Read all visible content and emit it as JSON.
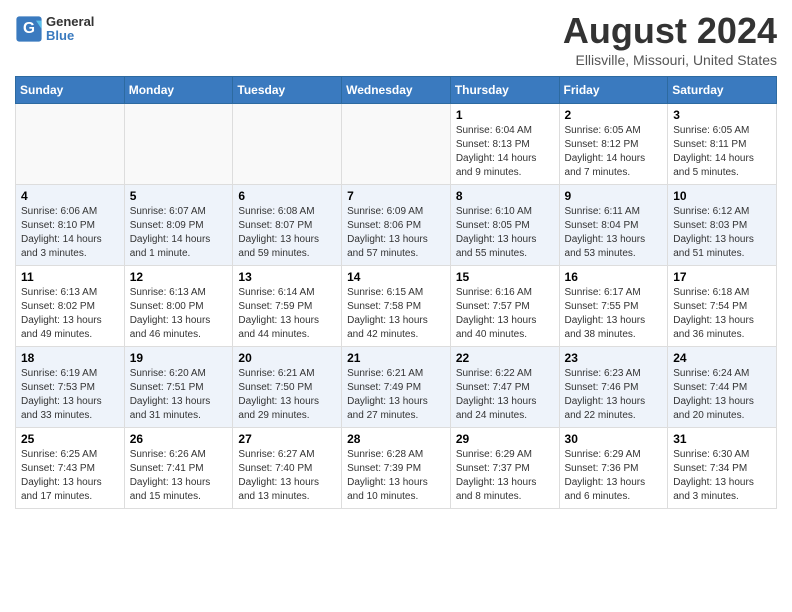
{
  "logo": {
    "general": "General",
    "blue": "Blue"
  },
  "title": "August 2024",
  "subtitle": "Ellisville, Missouri, United States",
  "days_of_week": [
    "Sunday",
    "Monday",
    "Tuesday",
    "Wednesday",
    "Thursday",
    "Friday",
    "Saturday"
  ],
  "weeks": [
    [
      {
        "day": "",
        "sunrise": "",
        "sunset": "",
        "daylight": ""
      },
      {
        "day": "",
        "sunrise": "",
        "sunset": "",
        "daylight": ""
      },
      {
        "day": "",
        "sunrise": "",
        "sunset": "",
        "daylight": ""
      },
      {
        "day": "",
        "sunrise": "",
        "sunset": "",
        "daylight": ""
      },
      {
        "day": "1",
        "sunrise": "Sunrise: 6:04 AM",
        "sunset": "Sunset: 8:13 PM",
        "daylight": "Daylight: 14 hours and 9 minutes."
      },
      {
        "day": "2",
        "sunrise": "Sunrise: 6:05 AM",
        "sunset": "Sunset: 8:12 PM",
        "daylight": "Daylight: 14 hours and 7 minutes."
      },
      {
        "day": "3",
        "sunrise": "Sunrise: 6:05 AM",
        "sunset": "Sunset: 8:11 PM",
        "daylight": "Daylight: 14 hours and 5 minutes."
      }
    ],
    [
      {
        "day": "4",
        "sunrise": "Sunrise: 6:06 AM",
        "sunset": "Sunset: 8:10 PM",
        "daylight": "Daylight: 14 hours and 3 minutes."
      },
      {
        "day": "5",
        "sunrise": "Sunrise: 6:07 AM",
        "sunset": "Sunset: 8:09 PM",
        "daylight": "Daylight: 14 hours and 1 minute."
      },
      {
        "day": "6",
        "sunrise": "Sunrise: 6:08 AM",
        "sunset": "Sunset: 8:07 PM",
        "daylight": "Daylight: 13 hours and 59 minutes."
      },
      {
        "day": "7",
        "sunrise": "Sunrise: 6:09 AM",
        "sunset": "Sunset: 8:06 PM",
        "daylight": "Daylight: 13 hours and 57 minutes."
      },
      {
        "day": "8",
        "sunrise": "Sunrise: 6:10 AM",
        "sunset": "Sunset: 8:05 PM",
        "daylight": "Daylight: 13 hours and 55 minutes."
      },
      {
        "day": "9",
        "sunrise": "Sunrise: 6:11 AM",
        "sunset": "Sunset: 8:04 PM",
        "daylight": "Daylight: 13 hours and 53 minutes."
      },
      {
        "day": "10",
        "sunrise": "Sunrise: 6:12 AM",
        "sunset": "Sunset: 8:03 PM",
        "daylight": "Daylight: 13 hours and 51 minutes."
      }
    ],
    [
      {
        "day": "11",
        "sunrise": "Sunrise: 6:13 AM",
        "sunset": "Sunset: 8:02 PM",
        "daylight": "Daylight: 13 hours and 49 minutes."
      },
      {
        "day": "12",
        "sunrise": "Sunrise: 6:13 AM",
        "sunset": "Sunset: 8:00 PM",
        "daylight": "Daylight: 13 hours and 46 minutes."
      },
      {
        "day": "13",
        "sunrise": "Sunrise: 6:14 AM",
        "sunset": "Sunset: 7:59 PM",
        "daylight": "Daylight: 13 hours and 44 minutes."
      },
      {
        "day": "14",
        "sunrise": "Sunrise: 6:15 AM",
        "sunset": "Sunset: 7:58 PM",
        "daylight": "Daylight: 13 hours and 42 minutes."
      },
      {
        "day": "15",
        "sunrise": "Sunrise: 6:16 AM",
        "sunset": "Sunset: 7:57 PM",
        "daylight": "Daylight: 13 hours and 40 minutes."
      },
      {
        "day": "16",
        "sunrise": "Sunrise: 6:17 AM",
        "sunset": "Sunset: 7:55 PM",
        "daylight": "Daylight: 13 hours and 38 minutes."
      },
      {
        "day": "17",
        "sunrise": "Sunrise: 6:18 AM",
        "sunset": "Sunset: 7:54 PM",
        "daylight": "Daylight: 13 hours and 36 minutes."
      }
    ],
    [
      {
        "day": "18",
        "sunrise": "Sunrise: 6:19 AM",
        "sunset": "Sunset: 7:53 PM",
        "daylight": "Daylight: 13 hours and 33 minutes."
      },
      {
        "day": "19",
        "sunrise": "Sunrise: 6:20 AM",
        "sunset": "Sunset: 7:51 PM",
        "daylight": "Daylight: 13 hours and 31 minutes."
      },
      {
        "day": "20",
        "sunrise": "Sunrise: 6:21 AM",
        "sunset": "Sunset: 7:50 PM",
        "daylight": "Daylight: 13 hours and 29 minutes."
      },
      {
        "day": "21",
        "sunrise": "Sunrise: 6:21 AM",
        "sunset": "Sunset: 7:49 PM",
        "daylight": "Daylight: 13 hours and 27 minutes."
      },
      {
        "day": "22",
        "sunrise": "Sunrise: 6:22 AM",
        "sunset": "Sunset: 7:47 PM",
        "daylight": "Daylight: 13 hours and 24 minutes."
      },
      {
        "day": "23",
        "sunrise": "Sunrise: 6:23 AM",
        "sunset": "Sunset: 7:46 PM",
        "daylight": "Daylight: 13 hours and 22 minutes."
      },
      {
        "day": "24",
        "sunrise": "Sunrise: 6:24 AM",
        "sunset": "Sunset: 7:44 PM",
        "daylight": "Daylight: 13 hours and 20 minutes."
      }
    ],
    [
      {
        "day": "25",
        "sunrise": "Sunrise: 6:25 AM",
        "sunset": "Sunset: 7:43 PM",
        "daylight": "Daylight: 13 hours and 17 minutes."
      },
      {
        "day": "26",
        "sunrise": "Sunrise: 6:26 AM",
        "sunset": "Sunset: 7:41 PM",
        "daylight": "Daylight: 13 hours and 15 minutes."
      },
      {
        "day": "27",
        "sunrise": "Sunrise: 6:27 AM",
        "sunset": "Sunset: 7:40 PM",
        "daylight": "Daylight: 13 hours and 13 minutes."
      },
      {
        "day": "28",
        "sunrise": "Sunrise: 6:28 AM",
        "sunset": "Sunset: 7:39 PM",
        "daylight": "Daylight: 13 hours and 10 minutes."
      },
      {
        "day": "29",
        "sunrise": "Sunrise: 6:29 AM",
        "sunset": "Sunset: 7:37 PM",
        "daylight": "Daylight: 13 hours and 8 minutes."
      },
      {
        "day": "30",
        "sunrise": "Sunrise: 6:29 AM",
        "sunset": "Sunset: 7:36 PM",
        "daylight": "Daylight: 13 hours and 6 minutes."
      },
      {
        "day": "31",
        "sunrise": "Sunrise: 6:30 AM",
        "sunset": "Sunset: 7:34 PM",
        "daylight": "Daylight: 13 hours and 3 minutes."
      }
    ]
  ]
}
